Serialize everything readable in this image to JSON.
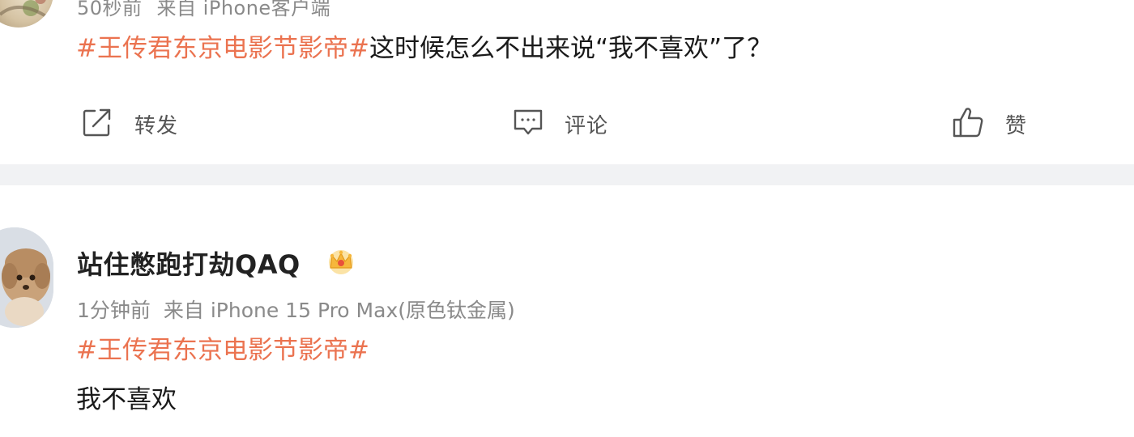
{
  "post1": {
    "meta_time": "50秒前",
    "meta_source": "来自 iPhone客户端",
    "hashtag": "#王传君东京电影节影帝#",
    "text": "这时候怎么不出来说“我不喜欢”了？",
    "actions": {
      "repost_label": "转发",
      "comment_label": "评论",
      "like_label": "赞"
    }
  },
  "post2": {
    "username": "站住憋跑打劫QAQ",
    "meta_time": "1分钟前",
    "meta_source": "来自 iPhone 15 Pro Max(原色钛金属)",
    "hashtag": "#王传君东京电影节影帝#",
    "text": "我不喜欢"
  },
  "colors": {
    "hashtag": "#eb7350",
    "meta": "#8a8a8a",
    "divider": "#f1f2f4"
  },
  "icons": {
    "repost": "share-out-icon",
    "comment": "comment-bubble-icon",
    "like": "thumbs-up-icon",
    "vip": "crown-badge-icon"
  }
}
